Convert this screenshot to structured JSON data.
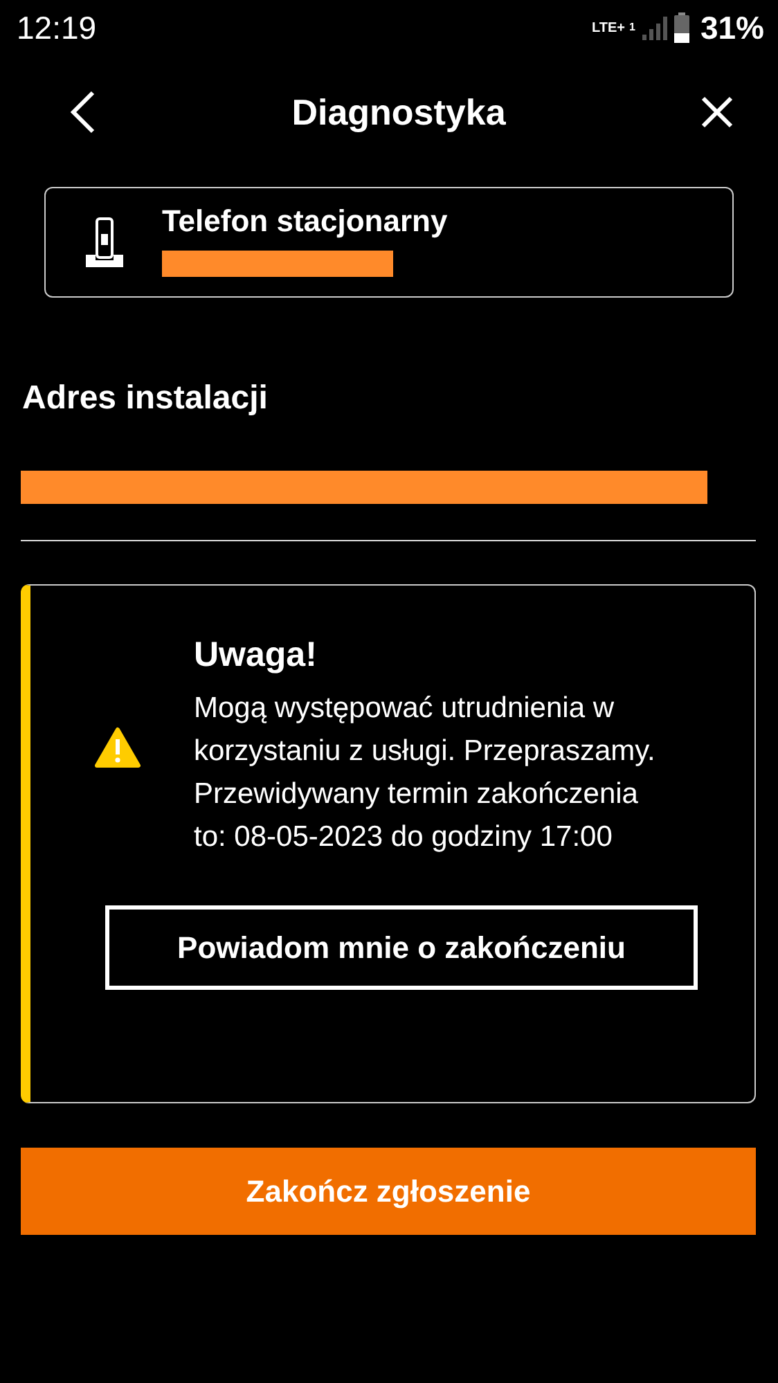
{
  "status_bar": {
    "time": "12:19",
    "network": "LTE+",
    "sim": "1",
    "battery": "31%"
  },
  "header": {
    "title": "Diagnostyka"
  },
  "service_card": {
    "title": "Telefon stacjonarny"
  },
  "address": {
    "heading": "Adres instalacji"
  },
  "alert": {
    "title": "Uwaga!",
    "message": "Mogą występować utrudnienia w korzystaniu z usługi. Przepraszamy. Przewidywany termin zakończenia to: 08-05-2023 do godziny 17:00",
    "button": "Powiadom mnie o zakończeniu"
  },
  "primary_button": "Zakończ zgłoszenie"
}
